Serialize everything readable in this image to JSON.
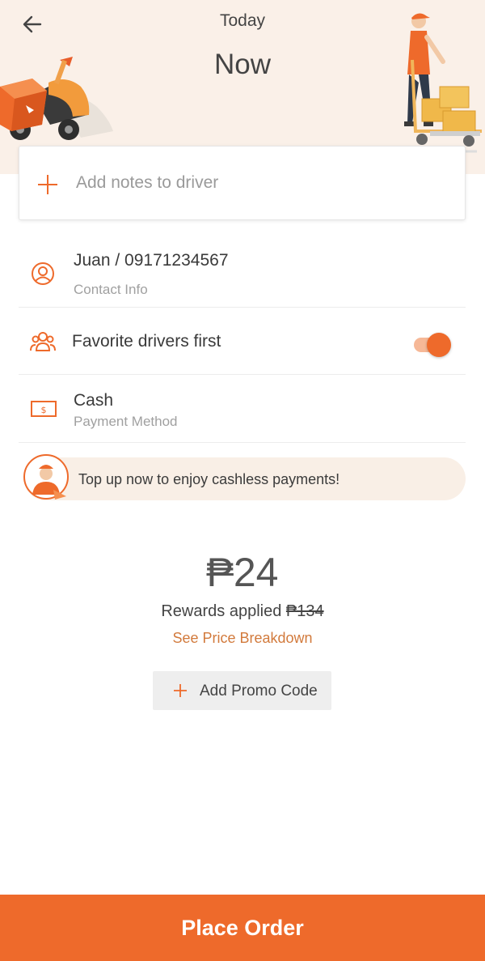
{
  "header": {
    "day": "Today",
    "time": "Now"
  },
  "notes": {
    "label": "Add notes to driver"
  },
  "contact": {
    "value": "Juan / 09171234567",
    "label": "Contact Info"
  },
  "favorite_drivers": {
    "label": "Favorite drivers first",
    "enabled": true
  },
  "payment": {
    "value": "Cash",
    "label": "Payment Method"
  },
  "topup_banner": {
    "text": "Top up now to enjoy cashless payments!"
  },
  "pricing": {
    "currency": "₱",
    "amount": "24",
    "rewards_label": "Rewards applied",
    "original_price": "₱134",
    "breakdown_link": "See Price Breakdown"
  },
  "promo": {
    "label": "Add Promo Code"
  },
  "footer": {
    "place_order_label": "Place Order"
  },
  "colors": {
    "accent": "#ee6a2b",
    "header_bg": "#faf0e8",
    "link": "#d27a3c"
  },
  "icons": {
    "back": "arrow-left-icon",
    "notes": "plus-icon",
    "contact": "user-circle-icon",
    "favorites": "group-icon",
    "payment": "cash-icon",
    "promo": "plus-icon"
  }
}
